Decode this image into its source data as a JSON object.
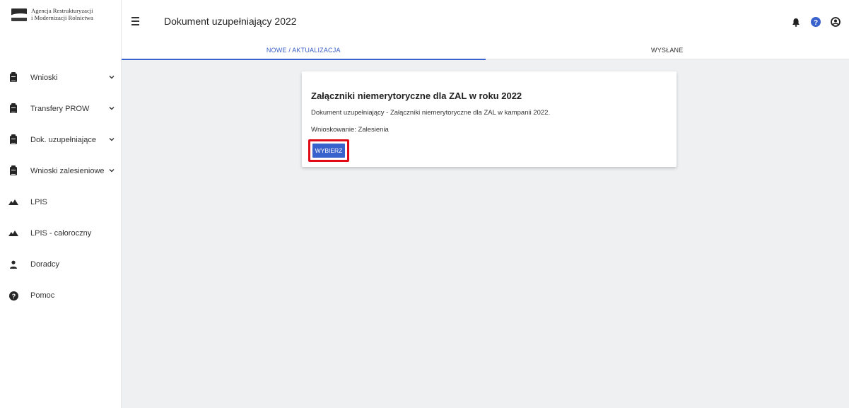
{
  "branding": {
    "logo_line1": "Agencja Restrukturyzacji",
    "logo_line2": "i Modernizacji Rolnictwa"
  },
  "header": {
    "title": "Dokument uzupełniający 2022",
    "icons": [
      "menu-icon",
      "bell-icon",
      "help-icon",
      "account-icon"
    ]
  },
  "tabs": [
    {
      "label": "NOWE / AKTUALIZACJA",
      "active": true
    },
    {
      "label": "WYSŁANE",
      "active": false
    }
  ],
  "sidebar": {
    "items": [
      {
        "label": "Wnioski",
        "icon": "clipboard-icon",
        "expandable": true
      },
      {
        "label": "Transfery PROW",
        "icon": "clipboard-icon",
        "expandable": true
      },
      {
        "label": "Dok. uzupełniające",
        "icon": "clipboard-icon",
        "expandable": true
      },
      {
        "label": "Wnioski zalesieniowe",
        "icon": "clipboard-icon",
        "expandable": true
      },
      {
        "label": "LPIS",
        "icon": "mountain-icon",
        "expandable": false
      },
      {
        "label": "LPIS - całoroczny",
        "icon": "mountain-icon",
        "expandable": false
      },
      {
        "label": "Doradcy",
        "icon": "person-icon",
        "expandable": false
      },
      {
        "label": "Pomoc",
        "icon": "help-icon",
        "expandable": false
      }
    ]
  },
  "card": {
    "title": "Załączniki niemerytoryczne dla ZAL w roku 2022",
    "description": "Dokument uzupełniający - Załączniki niemerytoryczne dla ZAL w kampanii 2022.",
    "kind": "Wnioskowanie: Zalesienia",
    "select_label": "WYBIERZ"
  },
  "colors": {
    "accent": "#3a62cc",
    "highlight": "#e10a17",
    "background": "#eef0f2"
  }
}
